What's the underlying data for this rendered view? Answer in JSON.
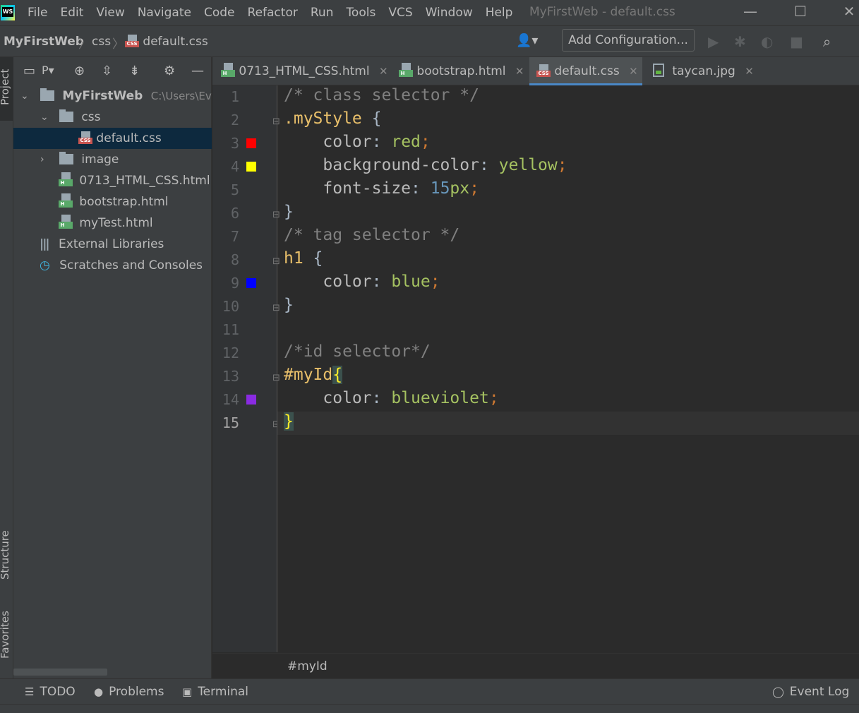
{
  "menubar": {
    "items": [
      "File",
      "Edit",
      "View",
      "Navigate",
      "Code",
      "Refactor",
      "Run",
      "Tools",
      "VCS",
      "Window",
      "Help"
    ],
    "window_title": "MyFirstWeb - default.css",
    "minimize": "—",
    "maximize": "☐",
    "close": "✕"
  },
  "navbar": {
    "crumbs": [
      "MyFirstWeb",
      "css",
      "default.css"
    ],
    "add_configuration": "Add Configuration..."
  },
  "left_stripe": {
    "project": "Project",
    "structure": "Structure",
    "favorites": "Favorites"
  },
  "project_panel": {
    "view_label": "P▾",
    "root": {
      "name": "MyFirstWeb",
      "path": "C:\\Users\\Ev"
    },
    "css_folder": "css",
    "selected_file": "default.css",
    "image_folder": "image",
    "files": [
      "0713_HTML_CSS.html",
      "bootstrap.html",
      "myTest.html"
    ],
    "external_libraries": "External Libraries",
    "scratches": "Scratches and Consoles"
  },
  "tabs": [
    {
      "label": "0713_HTML_CSS.html",
      "icon": "html-file-icon"
    },
    {
      "label": "bootstrap.html",
      "icon": "html-file-icon"
    },
    {
      "label": "default.css",
      "icon": "css-file-icon",
      "active": true
    },
    {
      "label": "taycan.jpg",
      "icon": "image-file-icon"
    }
  ],
  "editor": {
    "line_numbers": [
      "1",
      "2",
      "3",
      "4",
      "5",
      "6",
      "7",
      "8",
      "9",
      "10",
      "11",
      "12",
      "13",
      "14",
      "15"
    ],
    "current_line": 15,
    "lines": {
      "l1_comment": "/* class selector */",
      "l2_selector": ".myStyle",
      "l2_brace": " {",
      "l3_prop": "color",
      "l3_value": "red",
      "l4_prop": "background-color",
      "l4_value": "yellow",
      "l5_prop": "font-size",
      "l5_num": "15",
      "l5_unit": "px",
      "l6_brace": "}",
      "l7_comment": "/* tag selector */",
      "l8_selector": "h1",
      "l8_brace": " {",
      "l9_prop": "color",
      "l9_value": "blue",
      "l10_brace": "}",
      "l12_comment": "/*id selector*/",
      "l13_selector": "#myId",
      "l13_brace": "{",
      "l14_prop": "color",
      "l14_value": "blueviolet",
      "l15_brace": "}",
      "colon": ": ",
      "semicolon": ";"
    },
    "color_swatches": {
      "line3": "#ff0000",
      "line4": "#ffff00",
      "line9": "#0000ff",
      "line14": "#8a2be2"
    }
  },
  "editor_breadcrumb": "#myId",
  "bottom_tools": {
    "todo": "TODO",
    "problems": "Problems",
    "terminal": "Terminal",
    "event_log": "Event Log"
  }
}
